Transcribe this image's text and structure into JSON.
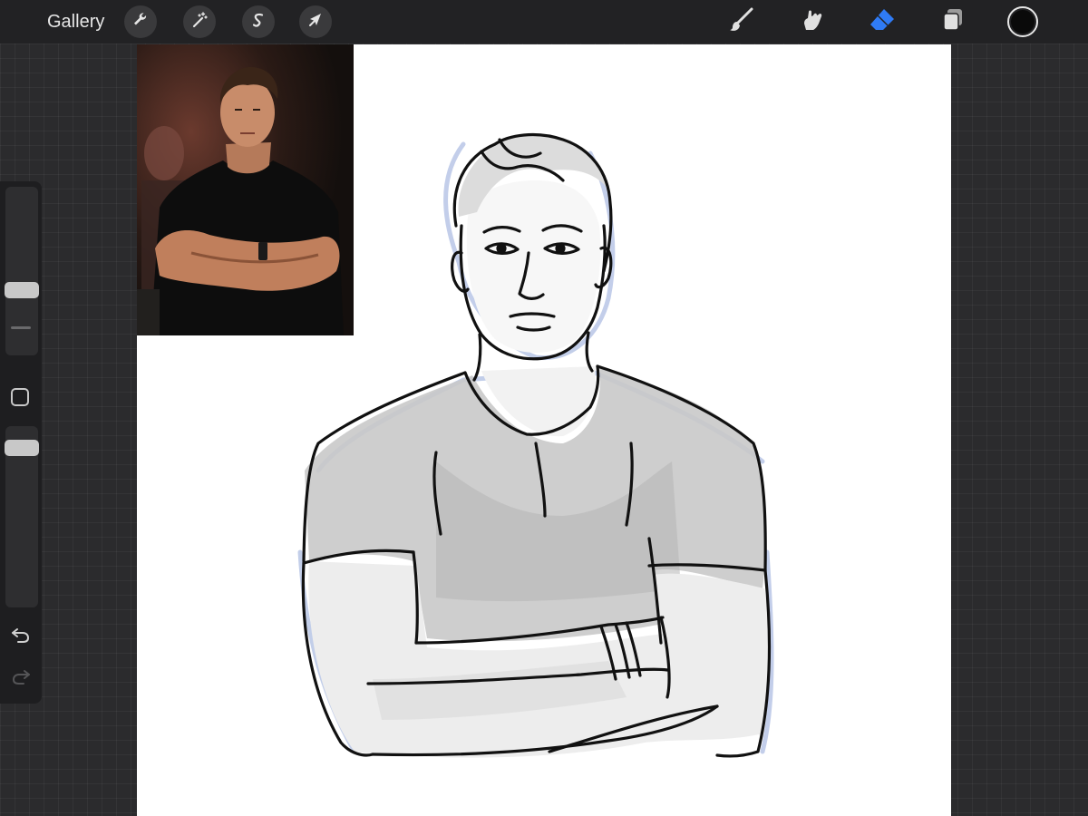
{
  "toolbar": {
    "gallery_label": "Gallery",
    "left_tools": [
      "wrench-icon",
      "magic-wand-icon",
      "selection-s-icon",
      "transform-arrow-icon"
    ],
    "right_tools": [
      "brush-icon",
      "smudge-icon",
      "eraser-icon",
      "layers-icon"
    ],
    "active_tool": "eraser",
    "active_color": "#0a0a0a",
    "accent_color": "#2f7bf5"
  },
  "sidebar": {
    "brush_size_label": "brush-size-slider",
    "opacity_label": "opacity-slider",
    "undo_icon": "undo-icon",
    "redo_icon": "redo-icon"
  }
}
